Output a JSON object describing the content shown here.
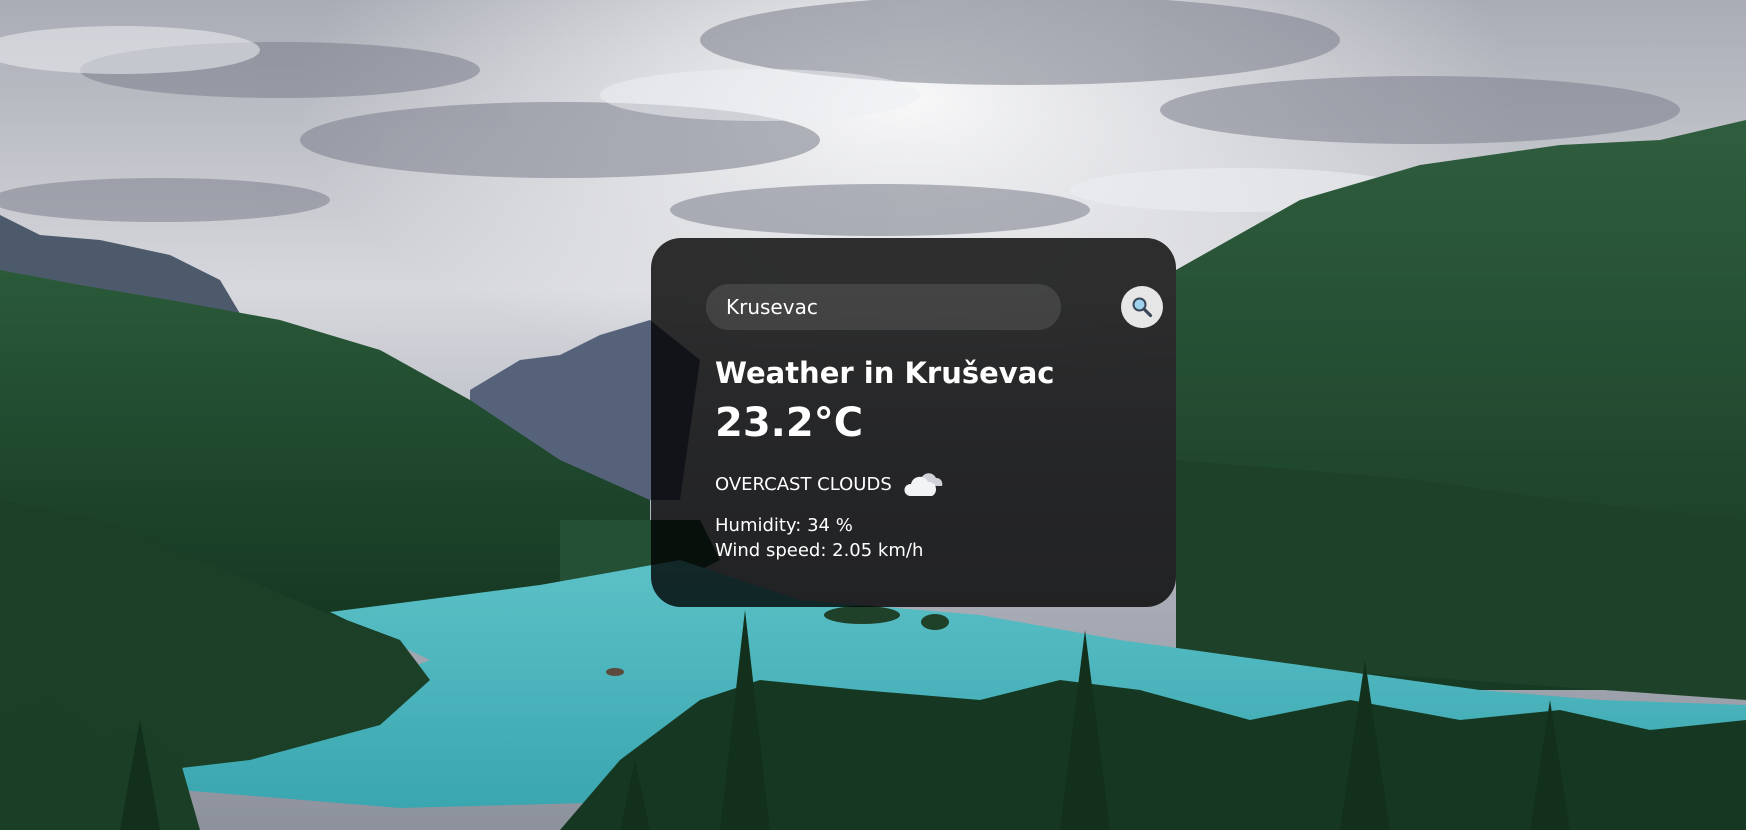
{
  "search": {
    "value": "Krusevac",
    "button_icon": "search-icon"
  },
  "weather": {
    "title": "Weather in Kruševac",
    "temperature": "23.2°C",
    "description": "OVERCAST CLOUDS",
    "icon": "cloud-icon",
    "humidity": "Humidity: 34 %",
    "wind": "Wind speed: 2.05 km/h"
  },
  "colors": {
    "card_background": "#000000",
    "text": "#ffffff",
    "search_button": "#e6e6e6",
    "lake": "#4cb5bd",
    "forest": "#1f4a2d",
    "sky": "#c9ccd3"
  }
}
